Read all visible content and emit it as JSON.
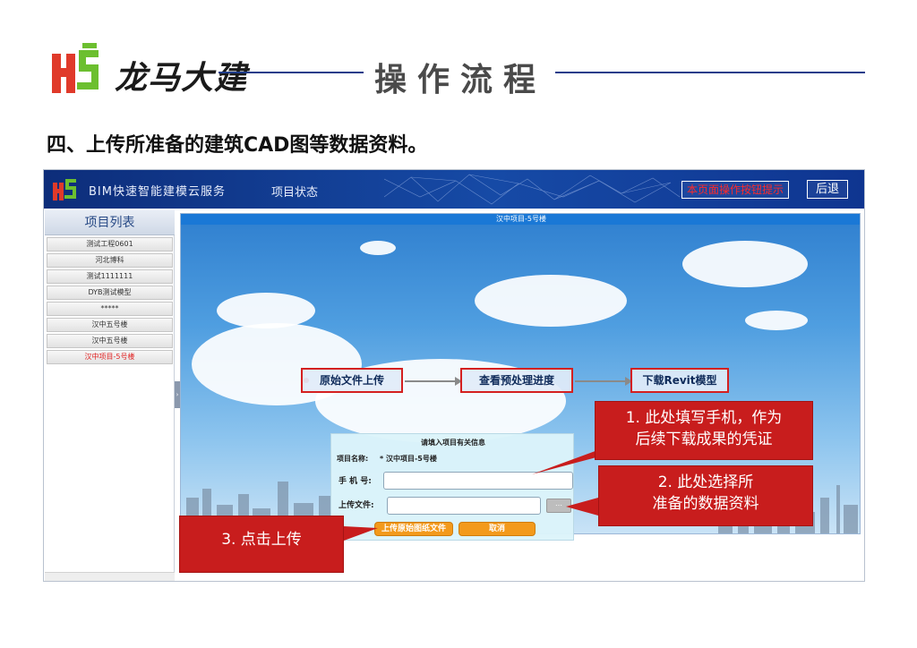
{
  "header": {
    "logo_text": "龙马大建",
    "title": "操作流程"
  },
  "section_heading": "四、上传所准备的建筑CAD图等数据资料。",
  "app": {
    "service_name": "BIM快速智能建模云服务",
    "nav_status": "项目状态",
    "hint_button": "本页面操作按钮提示",
    "back_button": "后退",
    "sidebar": {
      "title": "项目列表",
      "items": [
        {
          "label": "测试工程0601",
          "active": false
        },
        {
          "label": "河北博科",
          "active": false
        },
        {
          "label": "测试1111111",
          "active": false
        },
        {
          "label": "DYB测试模型",
          "active": false
        },
        {
          "label": "*****",
          "active": false
        },
        {
          "label": "汉中五号楼",
          "active": false
        },
        {
          "label": "汉中五号楼",
          "active": false
        },
        {
          "label": "汉中项目-5号楼",
          "active": true
        }
      ]
    },
    "main": {
      "title": "汉中项目-5号楼",
      "steps": [
        "原始文件上传",
        "查看预处理进度",
        "下载Revit模型"
      ],
      "form": {
        "caption": "请填入项目有关信息",
        "project_label": "项目名称:",
        "project_value": "* 汉中项目-5号楼",
        "phone_label": "手 机 号:",
        "phone_value": "",
        "file_label": "上传文件:",
        "file_value": "",
        "upload_button": "上传原始图纸文件",
        "cancel_button": "取消"
      }
    }
  },
  "callouts": [
    {
      "line1": "1. 此处填写手机，作为",
      "line2": "后续下载成果的凭证"
    },
    {
      "line1": "2. 此处选择所",
      "line2": "准备的数据资料"
    },
    {
      "line1": "3. 点击上传",
      "line2": ""
    }
  ],
  "colors": {
    "accent_blue": "#164aa6",
    "callout_red": "#c81d1d",
    "button_orange": "#f39a1c"
  }
}
